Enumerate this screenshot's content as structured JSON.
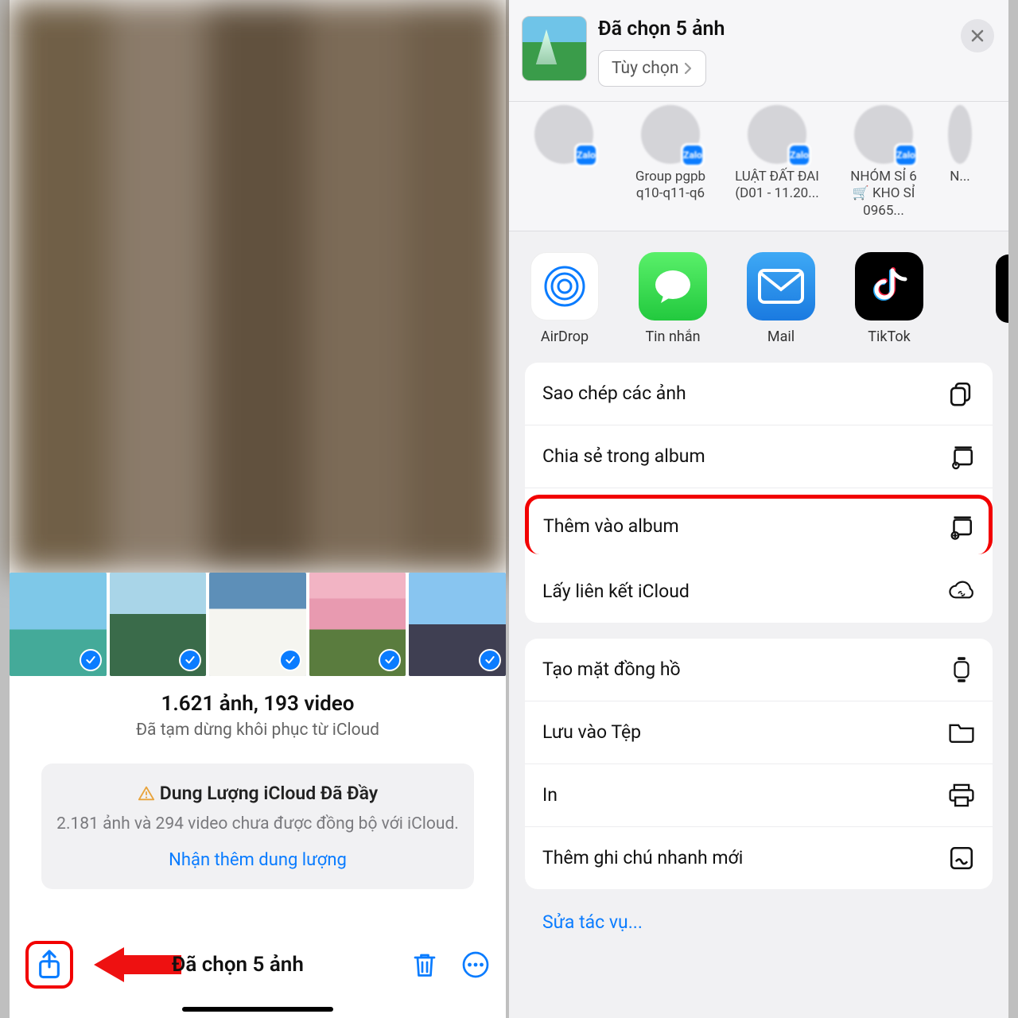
{
  "left": {
    "count_line": "1.621 ảnh, 193 video",
    "pause_line": "Đã tạm dừng khôi phục từ iCloud",
    "icloud": {
      "title": "Dung Lượng iCloud Đã Đầy",
      "subtitle": "2.181 ảnh và 294 video chưa được đồng bộ với iCloud.",
      "link": "Nhận thêm dung lượng"
    },
    "selected_title": "Đã chọn 5 ảnh"
  },
  "right": {
    "header_title": "Đã chọn 5 ảnh",
    "options_btn": "Tùy chọn",
    "contacts": [
      {
        "name": ""
      },
      {
        "name": "Group pgpb q10-q11-q6"
      },
      {
        "name": "LUẬT ĐẤT ĐAI (D01 - 11.20..."
      },
      {
        "name": "NHÓM SỈ 6 🛒 KHO SỈ 0965..."
      },
      {
        "name": "N..."
      }
    ],
    "apps": [
      {
        "label": "AirDrop"
      },
      {
        "label": "Tin nhắn"
      },
      {
        "label": "Mail"
      },
      {
        "label": "TikTok"
      }
    ],
    "group1": [
      {
        "label": "Sao chép các ảnh",
        "icon": "copy"
      },
      {
        "label": "Chia sẻ trong album",
        "icon": "share-album"
      }
    ],
    "group1_highlight": {
      "label": "Thêm vào album",
      "icon": "add-album"
    },
    "group1_tail": [
      {
        "label": "Lấy liên kết iCloud",
        "icon": "icloud-link"
      }
    ],
    "group2": [
      {
        "label": "Tạo mặt đồng hồ",
        "icon": "watch"
      },
      {
        "label": "Lưu vào Tệp",
        "icon": "folder"
      },
      {
        "label": "In",
        "icon": "printer"
      },
      {
        "label": "Thêm ghi chú nhanh mới",
        "icon": "note"
      }
    ],
    "edit_link": "Sửa tác vụ..."
  }
}
